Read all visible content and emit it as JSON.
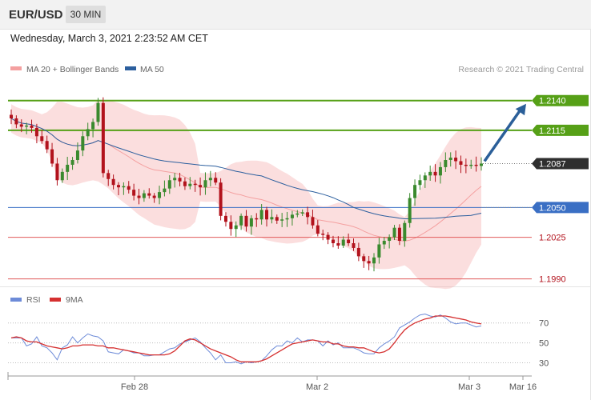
{
  "header": {
    "symbol": "EUR/USD",
    "timeframe": "30 MIN",
    "datetime": "Wednesday, March 3, 2021 2:23:52 AM CET"
  },
  "colors": {
    "bullish": "#3a8a2e",
    "bearish": "#b2121c",
    "resistance_green": "#56a017",
    "support_blue": "#3a6fc4",
    "red_level": "#e05a5a",
    "ma20_band": "#f4a0a0",
    "ma50": "#2c5f9e",
    "rsi": "#6d8bd8",
    "rsi_ma": "#d53030",
    "arrow": "#2b5f99",
    "current_price": "#2f2f2f"
  },
  "legend": {
    "ma20": "MA 20 + Bollinger Bands",
    "ma50": "MA 50",
    "credit": "Research © 2021 Trading Central"
  },
  "rsi_legend": {
    "rsi": "RSI",
    "ma": "9MA"
  },
  "chart_data": [
    {
      "type": "candlestick",
      "ylim": [
        1.1985,
        1.216
      ],
      "x_tick_labels": [
        "Feb 28",
        "Mar 2",
        "Mar 3",
        "Mar 16"
      ],
      "levels": [
        {
          "label": "1.2140",
          "value": 1.214,
          "kind": "resistance"
        },
        {
          "label": "1.2115",
          "value": 1.2115,
          "kind": "resistance"
        },
        {
          "label": "1.2087",
          "value": 1.2087,
          "kind": "current"
        },
        {
          "label": "1.2050",
          "value": 1.205,
          "kind": "pivot"
        },
        {
          "label": "1.2025",
          "value": 1.2025,
          "kind": "support"
        },
        {
          "label": "1.1990",
          "value": 1.199,
          "kind": "support"
        }
      ],
      "close": [
        1.2125,
        1.212,
        1.2118,
        1.2119,
        1.2117,
        1.211,
        1.2106,
        1.2099,
        1.2087,
        1.2073,
        1.208,
        1.2086,
        1.209,
        1.2098,
        1.211,
        1.2116,
        1.2122,
        1.2138,
        1.2079,
        1.2074,
        1.2069,
        1.2067,
        1.2068,
        1.2065,
        1.206,
        1.2058,
        1.2062,
        1.206,
        1.2058,
        1.2063,
        1.2066,
        1.2073,
        1.2075,
        1.2072,
        1.2068,
        1.207,
        1.2069,
        1.2067,
        1.2073,
        1.2075,
        1.2071,
        1.2043,
        1.2038,
        1.2032,
        1.2035,
        1.2043,
        1.2034,
        1.2041,
        1.204,
        1.2048,
        1.204,
        1.2042,
        1.2039,
        1.204,
        1.2041,
        1.2044,
        1.2045,
        1.2046,
        1.2042,
        1.2035,
        1.2028,
        1.2027,
        1.2023,
        1.202,
        1.2018,
        1.2023,
        1.202,
        1.2016,
        1.2009,
        1.2005,
        1.2003,
        1.2008,
        1.2019,
        1.2022,
        1.2025,
        1.2033,
        1.2022,
        1.2037,
        1.2058,
        1.2069,
        1.2073,
        1.2077,
        1.208,
        1.2077,
        1.2084,
        1.209,
        1.2092,
        1.2089,
        1.2086,
        1.2085,
        1.2086,
        1.2085,
        1.2087
      ]
    },
    {
      "type": "line",
      "title": "RSI",
      "ylim": [
        20,
        85
      ],
      "y_tick_labels": [
        "70",
        "50",
        "30"
      ],
      "series": [
        {
          "name": "RSI",
          "values": [
            55,
            55,
            55,
            47,
            49,
            56,
            47,
            45,
            40,
            33,
            45,
            48,
            56,
            50,
            55,
            59,
            57,
            56,
            52,
            41,
            40,
            39,
            43,
            42,
            40,
            40,
            37,
            37,
            38,
            38,
            41,
            44,
            45,
            49,
            51,
            53,
            55,
            51,
            45,
            40,
            33,
            38,
            30,
            30,
            31,
            29,
            31,
            30,
            31,
            32,
            37,
            43,
            47,
            47,
            52,
            50,
            55,
            51,
            53,
            53,
            52,
            47,
            52,
            48,
            50,
            45,
            45,
            45,
            43,
            40,
            39,
            39,
            45,
            49,
            52,
            56,
            65,
            68,
            71,
            75,
            78,
            79,
            77,
            76,
            78,
            75,
            71,
            69,
            70,
            70,
            68,
            66,
            67
          ]
        },
        {
          "name": "9MA",
          "values": [
            55,
            56,
            55,
            52,
            51,
            51,
            49,
            47,
            46,
            45,
            44,
            45,
            47,
            47,
            48,
            48,
            48,
            47,
            47,
            45,
            45,
            44,
            43,
            42,
            41,
            40,
            39,
            38,
            38,
            38,
            38,
            39,
            42,
            47,
            52,
            54,
            53,
            50,
            47,
            44,
            42,
            40,
            38,
            36,
            33,
            31,
            31,
            31,
            31,
            32,
            34,
            37,
            40,
            43,
            46,
            49,
            50,
            51,
            52,
            53,
            52,
            51,
            51,
            49,
            49,
            47,
            46,
            46,
            45,
            45,
            43,
            41,
            40,
            41,
            44,
            50,
            57,
            63,
            67,
            70,
            72,
            74,
            75,
            77,
            77,
            77,
            76,
            75,
            74,
            73,
            71,
            70,
            69
          ]
        }
      ]
    }
  ]
}
